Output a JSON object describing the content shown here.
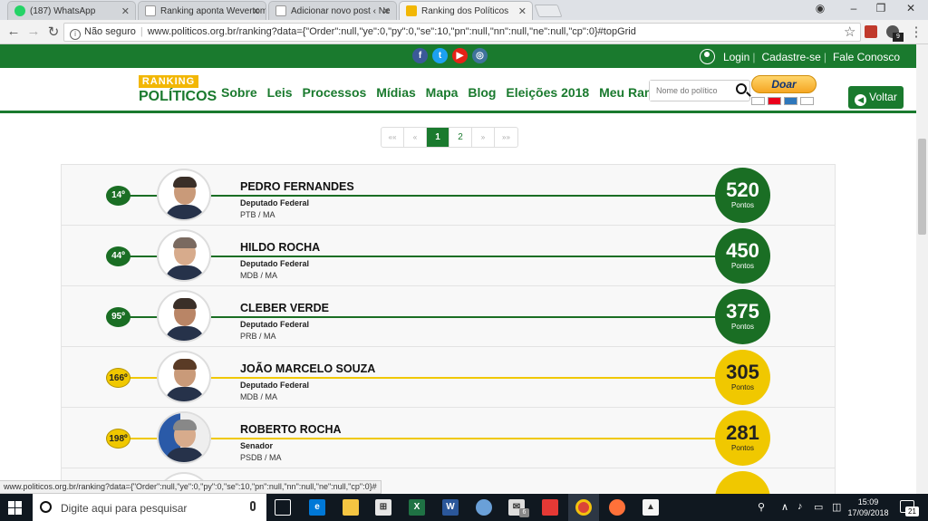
{
  "browser": {
    "tabs": [
      {
        "title": "(187) WhatsApp",
        "icon": "whatsapp-icon",
        "color": "#25d366"
      },
      {
        "title": "Ranking aponta Wevertom",
        "icon": "page-icon",
        "color": "#ffffff"
      },
      {
        "title": "Adicionar novo post ‹ Ne",
        "icon": "page-icon",
        "color": "#ffffff"
      },
      {
        "title": "Ranking dos Políticos",
        "icon": "ranking-icon",
        "color": "#f2b705"
      }
    ],
    "insecure_label": "Não seguro",
    "url": "www.politicos.org.br/ranking?data={\"Order\":null,\"ye\":0,\"py\":0,\"se\":10,\"pn\":null,\"nn\":null,\"ne\":null,\"cp\":0}#topGrid",
    "extension_badge": "9"
  },
  "site": {
    "colors": {
      "green": "#1a7a2e",
      "yellow": "#f0c800"
    },
    "social": [
      "facebook-icon",
      "twitter-icon",
      "youtube-icon",
      "instagram-icon"
    ],
    "toplinks": {
      "login": "Login",
      "signup": "Cadastre-se",
      "contact": "Fale Conosco"
    },
    "logo": {
      "line1": "RANKING",
      "line2": "POLÍTICOS"
    },
    "nav": [
      "Sobre",
      "Leis",
      "Processos",
      "Mídias",
      "Mapa",
      "Blog",
      "Eleições 2018",
      "Meu Ranking"
    ],
    "search_placeholder": "Nome do político",
    "donate": "Doar",
    "back": "Voltar"
  },
  "pager": {
    "first": "««",
    "prev": "«",
    "pages": [
      "1",
      "2"
    ],
    "current": "1",
    "next": "»",
    "last": "»»"
  },
  "politicians": [
    {
      "position": "14º",
      "name": "PEDRO FERNANDES",
      "role": "Deputado Federal",
      "party": "PTB / MA",
      "score": "520",
      "points_label": "Pontos",
      "tier": "green"
    },
    {
      "position": "44º",
      "name": "HILDO ROCHA",
      "role": "Deputado Federal",
      "party": "MDB / MA",
      "score": "450",
      "points_label": "Pontos",
      "tier": "green"
    },
    {
      "position": "95º",
      "name": "CLEBER VERDE",
      "role": "Deputado Federal",
      "party": "PRB / MA",
      "score": "375",
      "points_label": "Pontos",
      "tier": "green"
    },
    {
      "position": "166º",
      "name": "JOÃO MARCELO SOUZA",
      "role": "Deputado Federal",
      "party": "MDB / MA",
      "score": "305",
      "points_label": "Pontos",
      "tier": "yellow"
    },
    {
      "position": "198º",
      "name": "ROBERTO ROCHA",
      "role": "Senador",
      "party": "PSDB / MA",
      "score": "281",
      "points_label": "Pontos",
      "tier": "yellow"
    },
    {
      "position": "",
      "name": "",
      "role": "",
      "party": "",
      "score": "",
      "points_label": "",
      "tier": "yellow"
    }
  ],
  "status_url": "www.politicos.org.br/ranking?data={\"Order\":null,\"ye\":0,\"py\":0,\"se\":10,\"pn\":null,\"nn\":null,\"ne\":null,\"cp\":0}#",
  "taskbar": {
    "search_placeholder": "Digite aqui para pesquisar",
    "mail_badge": "6",
    "time": "15:09",
    "date": "17/09/2018",
    "notification_count": "21"
  }
}
